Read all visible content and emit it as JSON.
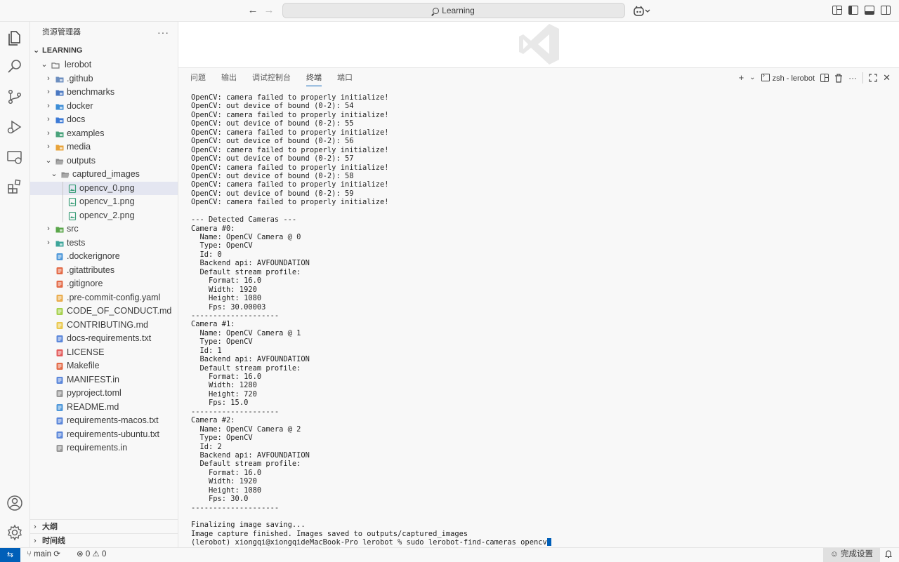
{
  "titlebar": {
    "search_text": "Learning"
  },
  "sidebar": {
    "title": "资源管理器",
    "workspace": "LEARNING",
    "root_folder": "lerobot",
    "items": [
      {
        "label": ".github",
        "type": "folder",
        "color": "#6c8ebf"
      },
      {
        "label": "benchmarks",
        "type": "folder",
        "color": "#4a78c2"
      },
      {
        "label": "docker",
        "type": "folder",
        "color": "#3c8dd6"
      },
      {
        "label": "docs",
        "type": "folder",
        "color": "#3c7ad6"
      },
      {
        "label": "examples",
        "type": "folder",
        "color": "#4aa37c"
      },
      {
        "label": "media",
        "type": "folder",
        "color": "#e8a33a"
      },
      {
        "label": "outputs",
        "type": "folder-open",
        "color": "#8d8d8d"
      },
      {
        "label": "captured_images",
        "type": "folder-open",
        "color": "#8d8d8d"
      },
      {
        "label": "opencv_0.png",
        "type": "image",
        "color": "#3d9f7a"
      },
      {
        "label": "opencv_1.png",
        "type": "image",
        "color": "#3d9f7a"
      },
      {
        "label": "opencv_2.png",
        "type": "image",
        "color": "#3d9f7a"
      },
      {
        "label": "src",
        "type": "folder",
        "color": "#5aa64a"
      },
      {
        "label": "tests",
        "type": "folder",
        "color": "#3da59a"
      },
      {
        "label": ".dockerignore",
        "type": "file",
        "color": "#3c8dd6"
      },
      {
        "label": ".gitattributes",
        "type": "file",
        "color": "#e05a33"
      },
      {
        "label": ".gitignore",
        "type": "file",
        "color": "#e05a33"
      },
      {
        "label": ".pre-commit-config.yaml",
        "type": "file",
        "color": "#e8a33a"
      },
      {
        "label": "CODE_OF_CONDUCT.md",
        "type": "file",
        "color": "#9ccc3a"
      },
      {
        "label": "CONTRIBUTING.md",
        "type": "file",
        "color": "#e8c23a"
      },
      {
        "label": "docs-requirements.txt",
        "type": "file",
        "color": "#4a7ad6"
      },
      {
        "label": "LICENSE",
        "type": "file",
        "color": "#e04a4a"
      },
      {
        "label": "Makefile",
        "type": "file",
        "color": "#e05a33"
      },
      {
        "label": "MANIFEST.in",
        "type": "file",
        "color": "#4a7ad6"
      },
      {
        "label": "pyproject.toml",
        "type": "file",
        "color": "#8d8d8d"
      },
      {
        "label": "README.md",
        "type": "file",
        "color": "#3c8dd6"
      },
      {
        "label": "requirements-macos.txt",
        "type": "file",
        "color": "#4a7ad6"
      },
      {
        "label": "requirements-ubuntu.txt",
        "type": "file",
        "color": "#4a7ad6"
      },
      {
        "label": "requirements.in",
        "type": "file",
        "color": "#8d8d8d"
      }
    ],
    "outline_label": "大纲",
    "timeline_label": "时间线"
  },
  "panel": {
    "tabs": [
      "问题",
      "输出",
      "调试控制台",
      "终端",
      "端口"
    ],
    "active_tab": "终端",
    "terminal_name": "zsh - lerobot"
  },
  "terminal": {
    "lines": [
      "OpenCV: camera failed to properly initialize!",
      "OpenCV: out device of bound (0-2): 54",
      "OpenCV: camera failed to properly initialize!",
      "OpenCV: out device of bound (0-2): 55",
      "OpenCV: camera failed to properly initialize!",
      "OpenCV: out device of bound (0-2): 56",
      "OpenCV: camera failed to properly initialize!",
      "OpenCV: out device of bound (0-2): 57",
      "OpenCV: camera failed to properly initialize!",
      "OpenCV: out device of bound (0-2): 58",
      "OpenCV: camera failed to properly initialize!",
      "OpenCV: out device of bound (0-2): 59",
      "OpenCV: camera failed to properly initialize!",
      "",
      "--- Detected Cameras ---",
      "Camera #0:",
      "  Name: OpenCV Camera @ 0",
      "  Type: OpenCV",
      "  Id: 0",
      "  Backend api: AVFOUNDATION",
      "  Default stream profile:",
      "    Format: 16.0",
      "    Width: 1920",
      "    Height: 1080",
      "    Fps: 30.00003",
      "--------------------",
      "Camera #1:",
      "  Name: OpenCV Camera @ 1",
      "  Type: OpenCV",
      "  Id: 1",
      "  Backend api: AVFOUNDATION",
      "  Default stream profile:",
      "    Format: 16.0",
      "    Width: 1280",
      "    Height: 720",
      "    Fps: 15.0",
      "--------------------",
      "Camera #2:",
      "  Name: OpenCV Camera @ 2",
      "  Type: OpenCV",
      "  Id: 2",
      "  Backend api: AVFOUNDATION",
      "  Default stream profile:",
      "    Format: 16.0",
      "    Width: 1920",
      "    Height: 1080",
      "    Fps: 30.0",
      "--------------------",
      "",
      "Finalizing image saving...",
      "Image capture finished. Images saved to outputs/captured_images"
    ],
    "prompt": "(lerobot) xiongqi@xiongqideMacBook-Pro lerobot % sudo lerobot-find-cameras opencv"
  },
  "statusbar": {
    "branch": "main",
    "errors": "0",
    "warnings": "0",
    "setup_label": "完成设置"
  },
  "colors": {
    "accent": "#005fb8",
    "selected_row": "#e4e6f1"
  }
}
